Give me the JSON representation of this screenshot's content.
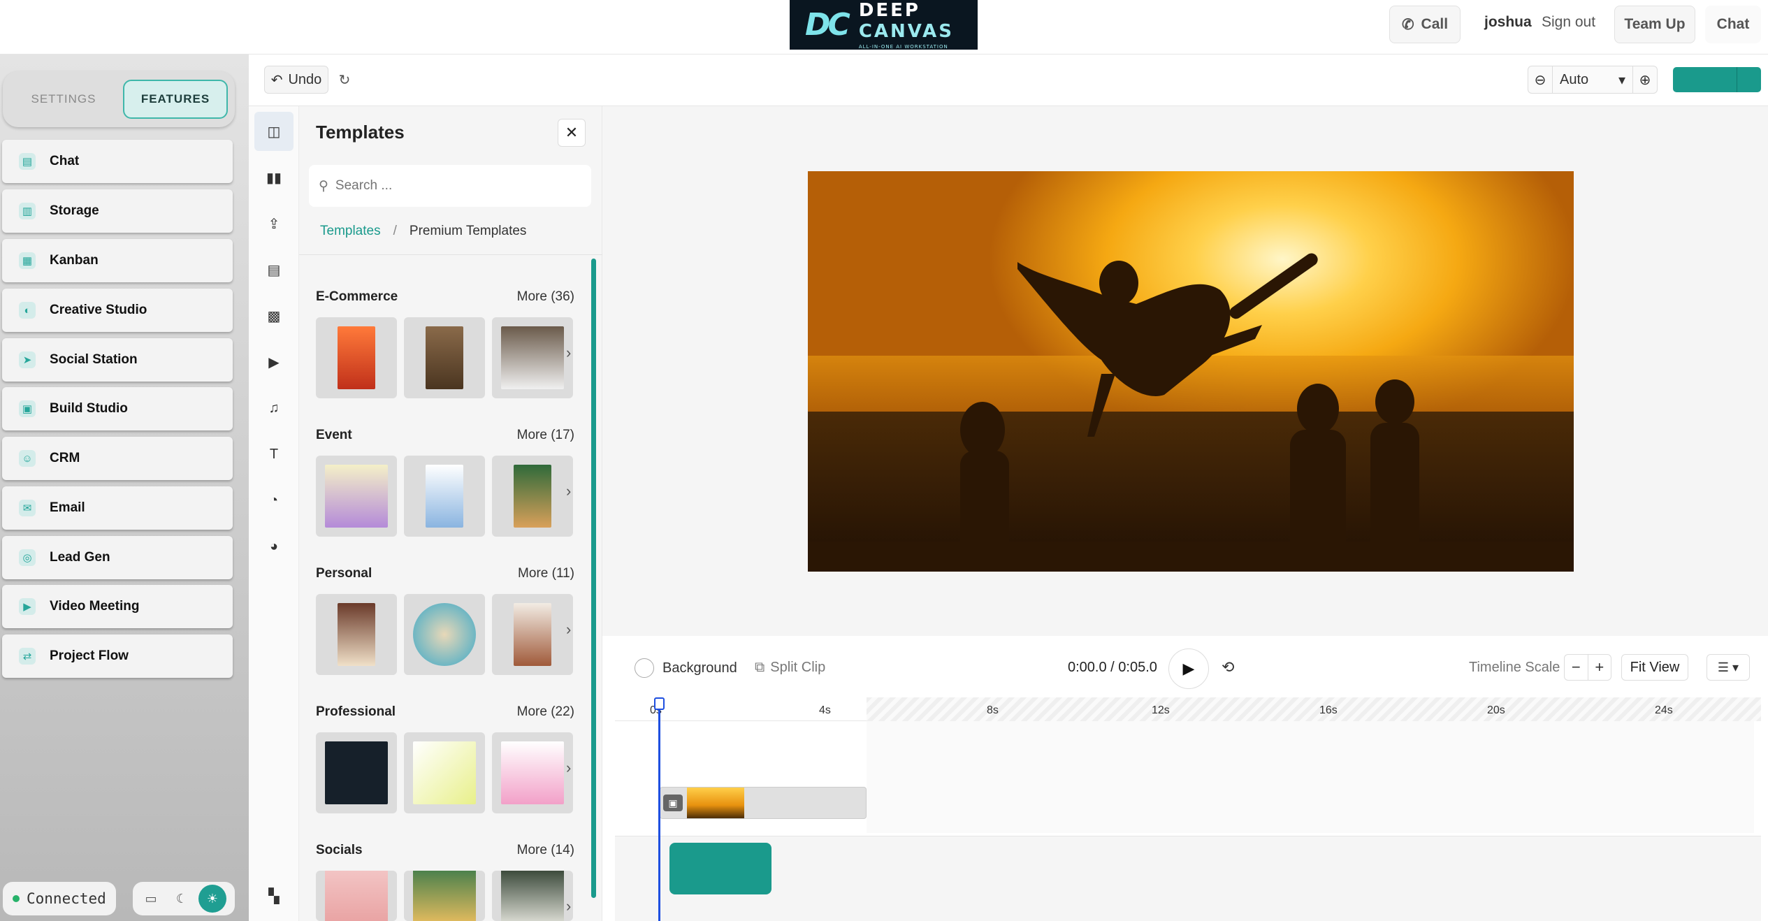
{
  "colors": {
    "accent": "#1a9a8c",
    "playhead": "#1e4fe0",
    "status_ok": "#27b26a"
  },
  "header": {
    "logo_mark": "DC",
    "logo_line1": "DEEP",
    "logo_line2": "CANVAS",
    "logo_tagline": "ALL-IN-ONE AI WORKSTATION",
    "call_label": "Call",
    "username": "joshua",
    "signout_label": "Sign out",
    "teamup_label": "Team Up",
    "chat_label": "Chat"
  },
  "sidebar": {
    "tabs": [
      {
        "label": "SETTINGS",
        "active": false
      },
      {
        "label": "FEATURES",
        "active": true
      }
    ],
    "items": [
      {
        "label": "Chat",
        "icon": "chat-icon"
      },
      {
        "label": "Storage",
        "icon": "storage-icon"
      },
      {
        "label": "Kanban",
        "icon": "kanban-icon"
      },
      {
        "label": "Creative Studio",
        "icon": "palette-icon"
      },
      {
        "label": "Social Station",
        "icon": "send-icon"
      },
      {
        "label": "Build Studio",
        "icon": "grid-icon"
      },
      {
        "label": "CRM",
        "icon": "users-icon"
      },
      {
        "label": "Email",
        "icon": "mail-icon"
      },
      {
        "label": "Lead Gen",
        "icon": "target-icon"
      },
      {
        "label": "Video Meeting",
        "icon": "video-icon"
      },
      {
        "label": "Project Flow",
        "icon": "flow-icon"
      }
    ],
    "status": "Connected"
  },
  "toolbar": {
    "undo_label": "Undo",
    "zoom_value": "Auto"
  },
  "templates": {
    "title": "Templates",
    "search_placeholder": "Search ...",
    "breadcrumb_root": "Templates",
    "breadcrumb_sep": "/",
    "breadcrumb_current": "Premium Templates",
    "categories": [
      {
        "name": "E-Commerce",
        "more": "More (36)"
      },
      {
        "name": "Event",
        "more": "More (17)"
      },
      {
        "name": "Personal",
        "more": "More (11)"
      },
      {
        "name": "Professional",
        "more": "More (22)"
      },
      {
        "name": "Socials",
        "more": "More (14)"
      }
    ]
  },
  "timeline": {
    "background_label": "Background",
    "split_label": "Split Clip",
    "time_readout": "0:00.0 / 0:05.0",
    "scale_label": "Timeline Scale",
    "fit_label": "Fit View",
    "ticks": [
      "0s",
      "4s",
      "8s",
      "12s",
      "16s",
      "20s",
      "24s"
    ]
  }
}
